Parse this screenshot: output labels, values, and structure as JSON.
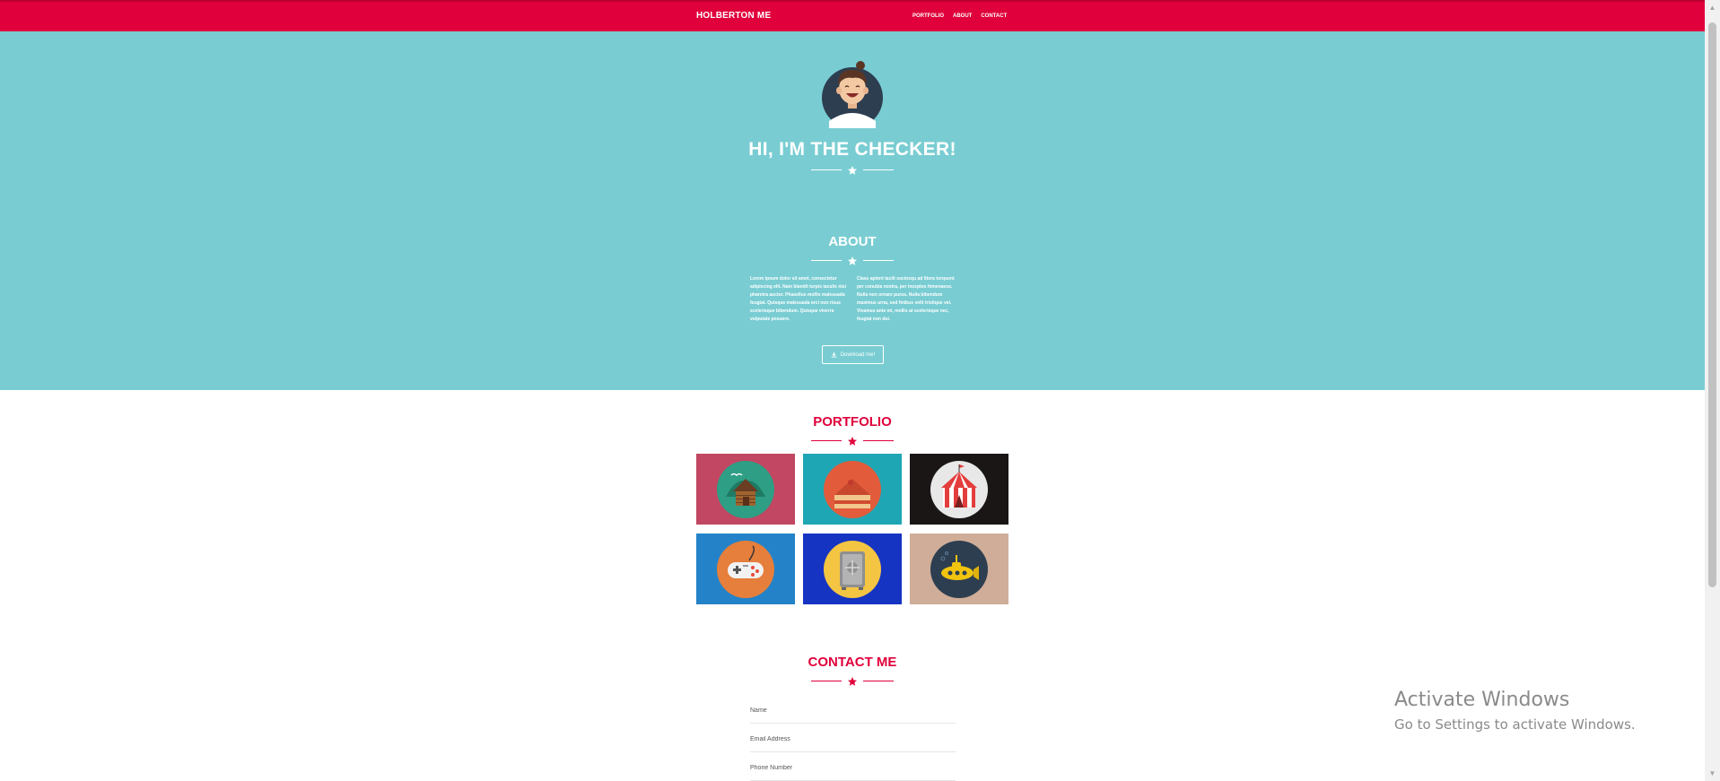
{
  "navbar": {
    "brand": "HOLBERTON ME",
    "links": [
      "PORTFOLIO",
      "ABOUT",
      "CONTACT"
    ],
    "bg_color": "#e0003b"
  },
  "hero": {
    "title": "HI, I'M THE CHECKER!",
    "bg_color": "#79cdd2"
  },
  "about": {
    "title": "ABOUT",
    "col1": "Lorem ipsum dolor sit amet, consectetur adipiscing elit. Nam blandit turpis iaculis nisi pharetra auctor. Phasellus mollis malesuada feugiat. Quisque malesuada orci non risus scelerisque bibendum. Quisque viverra vulputate posuere.",
    "col2": "Class aptent taciti sociosqu ad litora torquent per conubia nostra, per inceptos himenaeos. Nulla non ornare purus. Nulla bibendum maximus urna, sed finibus velit tristique vel. Vivamus ante mi, mollis at scelerisque nec, feugiat non dui.",
    "download_label": "Download me!",
    "download_icon": "download-icon"
  },
  "portfolio": {
    "title": "PORTFOLIO",
    "items": [
      {
        "name": "cabin",
        "bg": "#c14762"
      },
      {
        "name": "cake",
        "bg": "#1fa6b4"
      },
      {
        "name": "circus",
        "bg": "#1b1616"
      },
      {
        "name": "game-controller",
        "bg": "#2483c8"
      },
      {
        "name": "safe",
        "bg": "#1634c2"
      },
      {
        "name": "submarine",
        "bg": "#cfad98"
      }
    ]
  },
  "contact": {
    "title": "CONTACT ME",
    "name_placeholder": "Name",
    "email_placeholder": "Email Address",
    "phone_placeholder": "Phone Number"
  },
  "watermark": {
    "title": "Activate Windows",
    "subtitle": "Go to Settings to activate Windows."
  },
  "accent_color": "#e0003b"
}
